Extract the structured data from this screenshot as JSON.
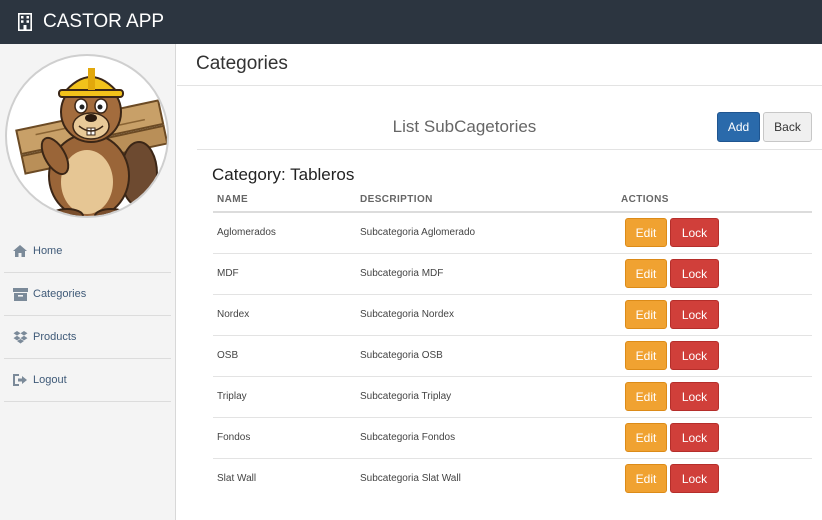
{
  "app": {
    "title": "CASTOR APP",
    "brand_icon": "building-icon"
  },
  "sidebar": {
    "avatar": "beaver-mascot",
    "items": [
      {
        "label": "Home",
        "icon": "home-icon"
      },
      {
        "label": "Categories",
        "icon": "archive-box-icon"
      },
      {
        "label": "Products",
        "icon": "dropbox-icon"
      },
      {
        "label": "Logout",
        "icon": "sign-out-icon"
      }
    ]
  },
  "page": {
    "title": "Categories"
  },
  "list": {
    "title": "List SubCagetories",
    "add_label": "Add",
    "back_label": "Back",
    "category_title": "Category: Tableros"
  },
  "table": {
    "headers": {
      "name": "NAME",
      "description": "DESCRIPTION",
      "actions": "ACTIONS"
    },
    "rows": [
      {
        "name": "Aglomerados",
        "description": "Subcategoria Aglomerado",
        "edit": "Edit",
        "lock": "Lock"
      },
      {
        "name": "MDF",
        "description": "Subcategoria MDF",
        "edit": "Edit",
        "lock": "Lock"
      },
      {
        "name": "Nordex",
        "description": "Subcategoria Nordex",
        "edit": "Edit",
        "lock": "Lock"
      },
      {
        "name": "OSB",
        "description": "Subcategoria OSB",
        "edit": "Edit",
        "lock": "Lock"
      },
      {
        "name": "Triplay",
        "description": "Subcategoria Triplay",
        "edit": "Edit",
        "lock": "Lock"
      },
      {
        "name": "Fondos",
        "description": "Subcategoria Fondos",
        "edit": "Edit",
        "lock": "Lock"
      },
      {
        "name": "Slat Wall",
        "description": "Subcategoria Slat Wall",
        "edit": "Edit",
        "lock": "Lock"
      }
    ]
  },
  "colors": {
    "topbar": "#2c3540",
    "primary": "#2a6aab",
    "warning": "#f0a231",
    "danger": "#d03f3a",
    "nav_text": "#3f5a78"
  }
}
